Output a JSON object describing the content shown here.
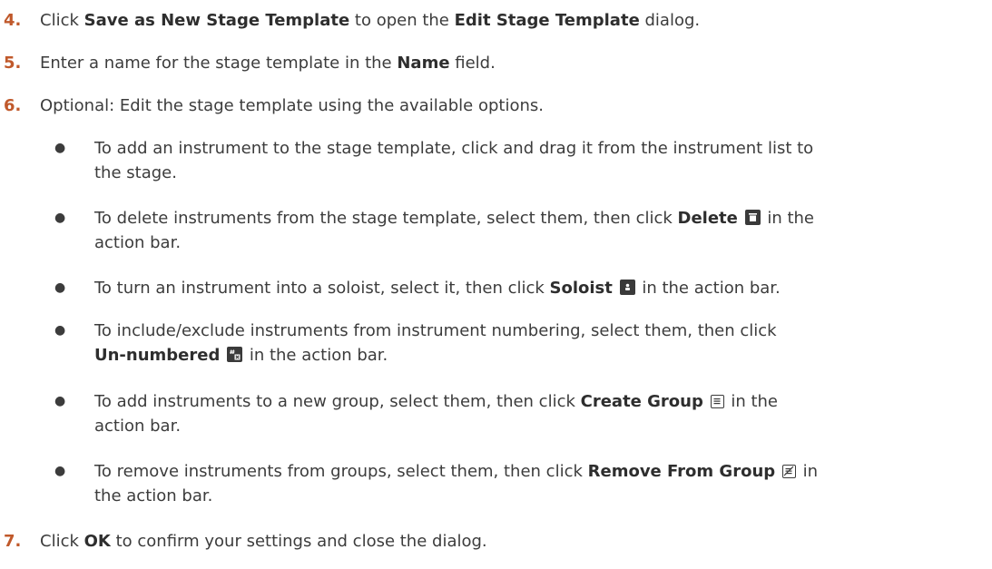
{
  "steps": [
    {
      "num": "4.",
      "parts": [
        "Click ",
        "Save as New Stage Template",
        " to open the ",
        "Edit Stage Template",
        " dialog."
      ]
    },
    {
      "num": "5.",
      "parts": [
        "Enter a name for the stage template in the ",
        "Name",
        " field."
      ]
    },
    {
      "num": "6.",
      "text": "Optional: Edit the stage template using the available options."
    },
    {
      "num": "7.",
      "parts": [
        "Click ",
        "OK",
        " to confirm your settings and close the dialog."
      ]
    }
  ],
  "bullets": [
    {
      "line1": "To add an instrument to the stage template, click and drag it from the instrument list to",
      "line2": "the stage."
    },
    {
      "pre": "To delete instruments from the stage template, select them, then click ",
      "bold": "Delete",
      "icon": "delete-icon",
      "post": " in the",
      "line2": "action bar."
    },
    {
      "pre": "To turn an instrument into a soloist, select it, then click ",
      "bold": "Soloist",
      "icon": "soloist-icon",
      "post": " in the action bar."
    },
    {
      "line1": "To include/exclude instruments from instrument numbering, select them, then click",
      "bold": "Un-numbered",
      "icon": "unnumbered-icon",
      "post": " in the action bar."
    },
    {
      "pre": "To add instruments to a new group, select them, then click ",
      "bold": "Create Group",
      "icon": "create-group-icon",
      "post": " in the",
      "line2": "action bar."
    },
    {
      "pre": "To remove instruments from groups, select them, then click ",
      "bold": "Remove From Group",
      "icon": "remove-from-group-icon",
      "post": " in",
      "line2": "the action bar."
    }
  ],
  "bullet_symbol": "●",
  "colors": {
    "step_number": "#c0592b",
    "text": "#3c3c3c",
    "icon": "#3a3a3a"
  }
}
